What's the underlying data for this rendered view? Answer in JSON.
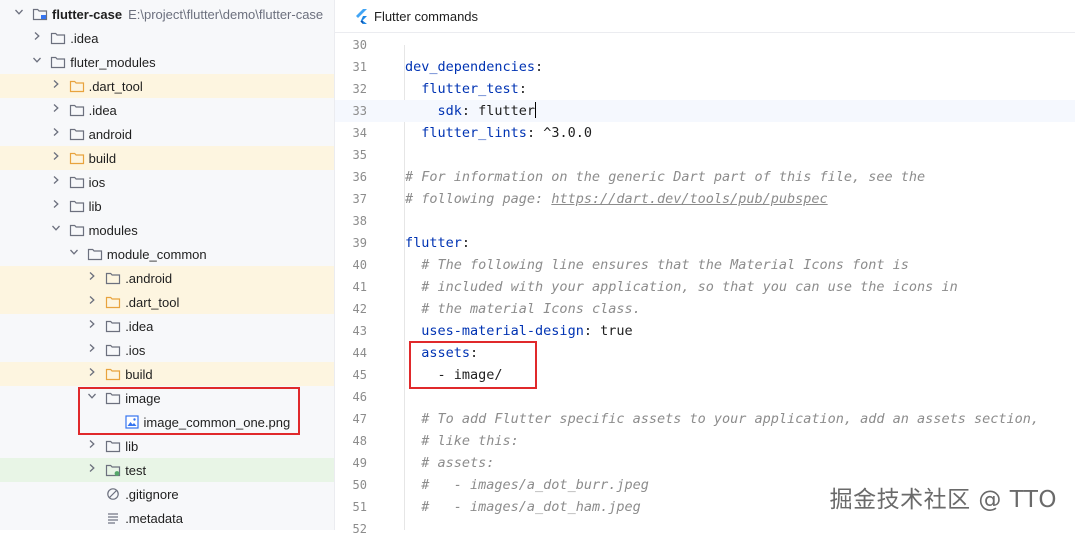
{
  "tree": {
    "rows": [
      {
        "indent": 0,
        "arrow": "down",
        "icon": "module-folder-icon",
        "label": "flutter-case",
        "path": "E:\\project\\flutter\\demo\\flutter-case",
        "style": "root"
      },
      {
        "indent": 1,
        "arrow": "right",
        "icon": "folder-icon",
        "label": ".idea",
        "style": "normal"
      },
      {
        "indent": 1,
        "arrow": "down",
        "icon": "folder-icon",
        "label": "fluter_modules",
        "style": "normal"
      },
      {
        "indent": 2,
        "arrow": "right",
        "icon": "folder-excluded-icon",
        "label": ".dart_tool",
        "style": "excluded"
      },
      {
        "indent": 2,
        "arrow": "right",
        "icon": "folder-icon",
        "label": ".idea",
        "style": "normal"
      },
      {
        "indent": 2,
        "arrow": "right",
        "icon": "folder-icon",
        "label": "android",
        "style": "normal"
      },
      {
        "indent": 2,
        "arrow": "right",
        "icon": "folder-excluded-icon",
        "label": "build",
        "style": "excluded"
      },
      {
        "indent": 2,
        "arrow": "right",
        "icon": "folder-icon",
        "label": "ios",
        "style": "normal"
      },
      {
        "indent": 2,
        "arrow": "right",
        "icon": "folder-icon",
        "label": "lib",
        "style": "normal"
      },
      {
        "indent": 2,
        "arrow": "down",
        "icon": "folder-icon",
        "label": "modules",
        "style": "normal"
      },
      {
        "indent": 3,
        "arrow": "down",
        "icon": "folder-icon",
        "label": "module_common",
        "style": "normal"
      },
      {
        "indent": 4,
        "arrow": "right",
        "icon": "folder-icon",
        "label": ".android",
        "style": "excluded"
      },
      {
        "indent": 4,
        "arrow": "right",
        "icon": "folder-excluded-icon",
        "label": ".dart_tool",
        "style": "excluded"
      },
      {
        "indent": 4,
        "arrow": "right",
        "icon": "folder-icon",
        "label": ".idea",
        "style": "normal"
      },
      {
        "indent": 4,
        "arrow": "right",
        "icon": "folder-icon",
        "label": ".ios",
        "style": "normal"
      },
      {
        "indent": 4,
        "arrow": "right",
        "icon": "folder-excluded-icon",
        "label": "build",
        "style": "excluded"
      },
      {
        "indent": 4,
        "arrow": "down",
        "icon": "folder-icon",
        "label": "image",
        "style": "normal"
      },
      {
        "indent": 5,
        "arrow": "none",
        "icon": "image-file-icon",
        "label": "image_common_one.png",
        "style": "normal"
      },
      {
        "indent": 4,
        "arrow": "right",
        "icon": "folder-icon",
        "label": "lib",
        "style": "normal"
      },
      {
        "indent": 4,
        "arrow": "right",
        "icon": "folder-test-icon",
        "label": "test",
        "style": "test"
      },
      {
        "indent": 4,
        "arrow": "none",
        "icon": "ignore-file-icon",
        "label": ".gitignore",
        "style": "normal"
      },
      {
        "indent": 4,
        "arrow": "none",
        "icon": "text-file-icon",
        "label": ".metadata",
        "style": "normal"
      }
    ]
  },
  "editor": {
    "toolbar": {
      "flutter_commands": "Flutter commands"
    },
    "active_line": 33,
    "lines": [
      {
        "n": "30",
        "tokens": []
      },
      {
        "n": "31",
        "tokens": [
          {
            "t": "dev_dependencies",
            "c": "k"
          },
          {
            "t": ":",
            "c": "v"
          }
        ]
      },
      {
        "n": "32",
        "tokens": [
          {
            "t": "  "
          },
          {
            "t": "flutter_test",
            "c": "k"
          },
          {
            "t": ":",
            "c": "v"
          }
        ]
      },
      {
        "n": "33",
        "tokens": [
          {
            "t": "    "
          },
          {
            "t": "sdk",
            "c": "k"
          },
          {
            "t": ": flutter",
            "c": "v"
          }
        ],
        "caret": true
      },
      {
        "n": "34",
        "tokens": [
          {
            "t": "  "
          },
          {
            "t": "flutter_lints",
            "c": "k"
          },
          {
            "t": ": ^3.0.0",
            "c": "v"
          }
        ]
      },
      {
        "n": "35",
        "tokens": []
      },
      {
        "n": "36",
        "tokens": [
          {
            "t": "# For information on the generic Dart part of this file, see the",
            "c": "c"
          }
        ]
      },
      {
        "n": "37",
        "tokens": [
          {
            "t": "# following page: ",
            "c": "c"
          },
          {
            "t": "https://dart.dev/tools/pub/pubspec",
            "c": "c u"
          }
        ]
      },
      {
        "n": "38",
        "tokens": []
      },
      {
        "n": "39",
        "tokens": [
          {
            "t": "flutter",
            "c": "k"
          },
          {
            "t": ":",
            "c": "v"
          }
        ]
      },
      {
        "n": "40",
        "tokens": [
          {
            "t": "  "
          },
          {
            "t": "# The following line ensures that the Material Icons font is",
            "c": "c"
          }
        ]
      },
      {
        "n": "41",
        "tokens": [
          {
            "t": "  "
          },
          {
            "t": "# included with your application, so that you can use the icons in",
            "c": "c"
          }
        ]
      },
      {
        "n": "42",
        "tokens": [
          {
            "t": "  "
          },
          {
            "t": "# the material Icons class.",
            "c": "c"
          }
        ]
      },
      {
        "n": "43",
        "tokens": [
          {
            "t": "  "
          },
          {
            "t": "uses-material-design",
            "c": "k"
          },
          {
            "t": ": true",
            "c": "v"
          }
        ]
      },
      {
        "n": "44",
        "tokens": [
          {
            "t": "  "
          },
          {
            "t": "assets",
            "c": "k"
          },
          {
            "t": ":",
            "c": "v"
          }
        ]
      },
      {
        "n": "45",
        "tokens": [
          {
            "t": "    - image/",
            "c": "v"
          }
        ]
      },
      {
        "n": "46",
        "tokens": []
      },
      {
        "n": "47",
        "tokens": [
          {
            "t": "  "
          },
          {
            "t": "# To add Flutter specific assets to your application, add an assets section,",
            "c": "c"
          }
        ]
      },
      {
        "n": "48",
        "tokens": [
          {
            "t": "  "
          },
          {
            "t": "# like this:",
            "c": "c"
          }
        ]
      },
      {
        "n": "49",
        "tokens": [
          {
            "t": "  "
          },
          {
            "t": "# assets:",
            "c": "c"
          }
        ]
      },
      {
        "n": "50",
        "tokens": [
          {
            "t": "  "
          },
          {
            "t": "#   - images/a_dot_burr.jpeg",
            "c": "c"
          }
        ]
      },
      {
        "n": "51",
        "tokens": [
          {
            "t": "  "
          },
          {
            "t": "#   - images/a_dot_ham.jpeg",
            "c": "c"
          }
        ]
      },
      {
        "n": "52",
        "tokens": []
      }
    ]
  },
  "watermark": "掘金技术社区 @ TTO",
  "colors": {
    "keyword": "#0033b3",
    "comment": "#8c8c8c",
    "highlight_box": "#e0292b",
    "excluded_bg": "#fdf5e0",
    "test_bg": "#e8f5e6"
  }
}
